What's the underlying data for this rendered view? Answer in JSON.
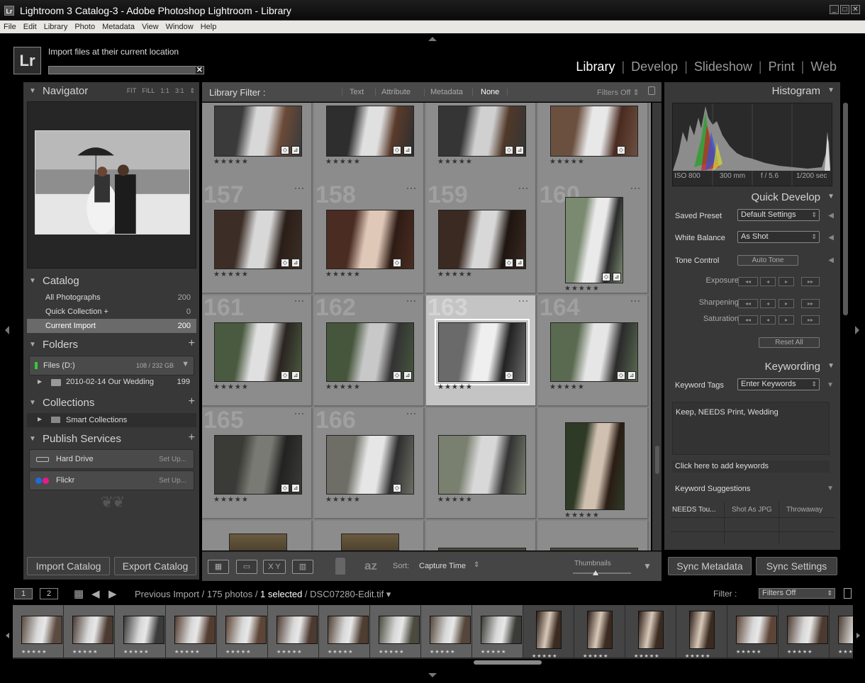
{
  "window": {
    "title": "Lightroom 3 Catalog-3 - Adobe Photoshop Lightroom - Library",
    "app_icon": "Lr",
    "controls": [
      "_",
      "□",
      "✕"
    ]
  },
  "menu": [
    "File",
    "Edit",
    "Library",
    "Photo",
    "Metadata",
    "View",
    "Window",
    "Help"
  ],
  "identity": {
    "logo": "Lr",
    "status_text": "Import files at their current location",
    "progress": 0.95
  },
  "modules": [
    "Library",
    "Develop",
    "Slideshow",
    "Print",
    "Web"
  ],
  "active_module": "Library",
  "navigator": {
    "title": "Navigator",
    "options": [
      "FIT",
      "FILL",
      "1:1",
      "3:1"
    ]
  },
  "catalog": {
    "title": "Catalog",
    "items": [
      {
        "name": "All Photographs",
        "count": "200"
      },
      {
        "name": "Quick Collection  +",
        "count": "0"
      },
      {
        "name": "Current Import",
        "count": "200"
      }
    ]
  },
  "folders": {
    "title": "Folders",
    "drive": "Files (D:)",
    "drive_space": "108 / 232 GB",
    "folder": "2010-02-14 Our Wedding",
    "folder_count": "199"
  },
  "collections": {
    "title": "Collections",
    "item": "Smart Collections"
  },
  "publish": {
    "title": "Publish Services",
    "services": [
      {
        "name": "Hard Drive",
        "action": "Set Up..."
      },
      {
        "name": "Flickr",
        "action": "Set Up..."
      }
    ]
  },
  "left_buttons": {
    "import": "Import Catalog",
    "export": "Export Catalog"
  },
  "filter_bar": {
    "label": "Library Filter :",
    "options": [
      "Text",
      "Attribute",
      "Metadata",
      "None"
    ],
    "active": "None",
    "filters_off": "Filters Off ⇕"
  },
  "grid": {
    "numbers": [
      "",
      "",
      "",
      "",
      "157",
      "158",
      "159",
      "160",
      "161",
      "162",
      "163",
      "164",
      "165",
      "166",
      "",
      ""
    ],
    "stars": "★★★★★",
    "dots": "···",
    "selected_index": 10
  },
  "toolbar": {
    "sort_label": "Sort:",
    "sort_value": "Capture Time",
    "thumbnails_label": "Thumbnails",
    "icon_names": [
      "grid-view-icon",
      "loupe-view-icon",
      "compare-view-icon",
      "survey-view-icon",
      "painter-icon",
      "sort-direction-icon"
    ]
  },
  "histogram": {
    "title": "Histogram",
    "iso": "ISO 800",
    "focal": "300 mm",
    "aperture": "f / 5.6",
    "shutter": "1/200 sec"
  },
  "quick_develop": {
    "title": "Quick Develop",
    "saved_preset_label": "Saved Preset",
    "saved_preset_value": "Default Settings",
    "white_balance_label": "White Balance",
    "white_balance_value": "As Shot",
    "tone_control_label": "Tone Control",
    "auto_tone": "Auto Tone",
    "exposure": "Exposure",
    "sharpening": "Sharpening",
    "saturation": "Saturation",
    "reset_all": "Reset All",
    "stepper_glyphs": [
      "◂◂",
      "◂",
      "▸",
      "▸▸"
    ]
  },
  "keywording": {
    "title": "Keywording",
    "tags_label": "Keyword Tags",
    "tags_select": "Enter Keywords",
    "keywords": "Keep, NEEDS Print, Wedding",
    "add_hint": "Click here to add keywords",
    "suggestions_label": "Keyword Suggestions",
    "suggestions": [
      "NEEDS Tou...",
      "Shot As JPG",
      "Throwaway"
    ]
  },
  "right_buttons": {
    "sync_metadata": "Sync Metadata",
    "sync_settings": "Sync Settings"
  },
  "filmstrip": {
    "screen1": "1",
    "screen2": "2",
    "source": "Previous Import / 175 photos / ",
    "selected": "1 selected",
    "file": " / DSC07280-Edit.tif ▾",
    "filter_label": "Filter :",
    "filter_value": "Filters Off",
    "stars": "★★★★★"
  },
  "colors": {
    "bg": "#000000",
    "panel": "#383838",
    "grid": "#8c8c8c",
    "selected_cell": "#c4c4c4",
    "active_text": "#ffffff"
  }
}
